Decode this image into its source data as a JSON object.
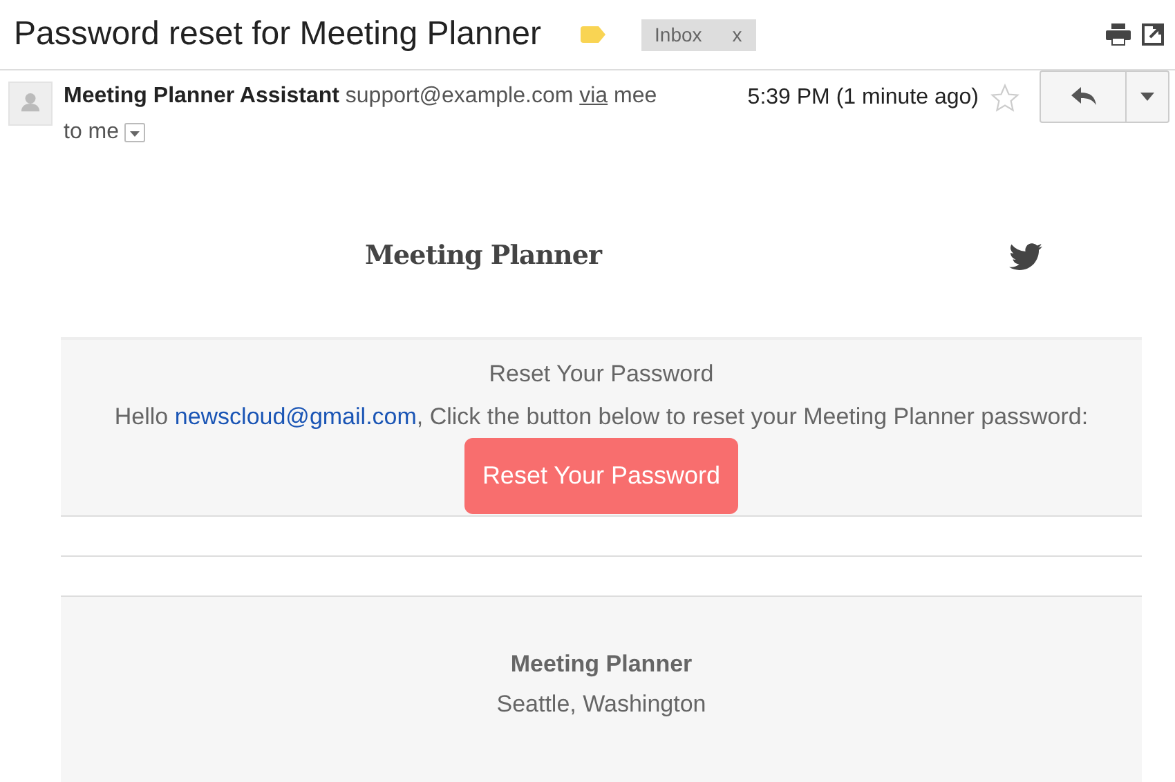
{
  "subject": "Password reset for Meeting Planner",
  "label": {
    "text": "Inbox",
    "close": "x"
  },
  "message": {
    "sender_name": "Meeting Planner Assistant",
    "sender_email": "support@example.com",
    "via": "via",
    "via_domain": "mee",
    "recipient": "to me",
    "time": "5:39 PM (1 minute ago)",
    "starred": false
  },
  "email_body": {
    "logo": "Meeting Planner",
    "heading": "Reset Your Password",
    "greeting": "Hello ",
    "email_link": "newscloud@gmail.com",
    "instruction": ", Click the button below to reset your Meeting Planner password:",
    "button": "Reset Your Password",
    "footer_name": "Meeting Planner",
    "footer_location": "Seattle, Washington"
  }
}
